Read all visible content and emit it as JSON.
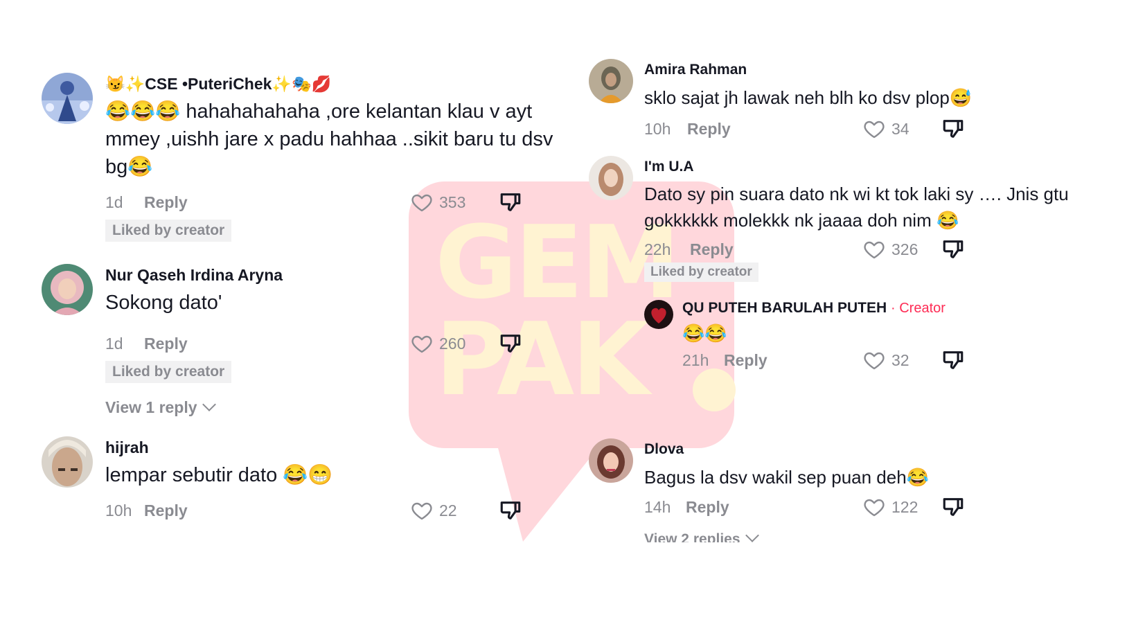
{
  "watermark": {
    "line1": "GEM",
    "line2": "PAK"
  },
  "left_comments": [
    {
      "username": "😼✨CSE •PuteriChek✨🎭💋",
      "text": "😂😂😂 hahahahahaha ,ore kelantan klau v ayt mmey ,uishh jare x padu hahhaa ..sikit baru tu dsv bg😂",
      "time": "1d",
      "reply": "Reply",
      "likes": "353",
      "liked_by": "Liked by creator"
    },
    {
      "username": "Nur Qaseh Irdina Aryna",
      "text": "Sokong dato'",
      "time": "1d",
      "reply": "Reply",
      "likes": "260",
      "liked_by": "Liked by creator",
      "view_replies": "View 1 reply"
    },
    {
      "username": "hijrah",
      "text": "lempar sebutir dato 😂😁",
      "time": "10h",
      "reply": "Reply",
      "likes": "22"
    }
  ],
  "right_comments": [
    {
      "username": "Amira Rahman",
      "text": "sklo sajat jh lawak neh blh ko dsv plop😅",
      "time": "10h",
      "reply": "Reply",
      "likes": "34"
    },
    {
      "username": "I'm U.A",
      "text": "Dato sy pin suara dato nk wi kt tok laki sy …. Jnis gtu gokkkkkk molekkk nk jaaaa doh nim 😂",
      "time": "22h",
      "reply": "Reply",
      "likes": "326",
      "liked_by": "Liked by creator"
    },
    {
      "username": "QU PUTEH BARULAH PUTEH",
      "creator_tag": "· Creator",
      "text": "😂😂",
      "time": "21h",
      "reply": "Reply",
      "likes": "32"
    },
    {
      "username": "Dlova",
      "text": "Bagus la dsv wakil sep puan deh😂",
      "time": "14h",
      "reply": "Reply",
      "likes": "122",
      "view_replies": "View 2 replies"
    }
  ],
  "colors": {
    "accent": "#fe2c55",
    "muted": "#8a8b91",
    "text": "#161823",
    "watermark_pink": "#ffd7dc",
    "watermark_cream": "#fff3d2"
  },
  "icons": {
    "like": "heart-outline-icon",
    "dislike": "thumbs-down-outline-icon"
  }
}
